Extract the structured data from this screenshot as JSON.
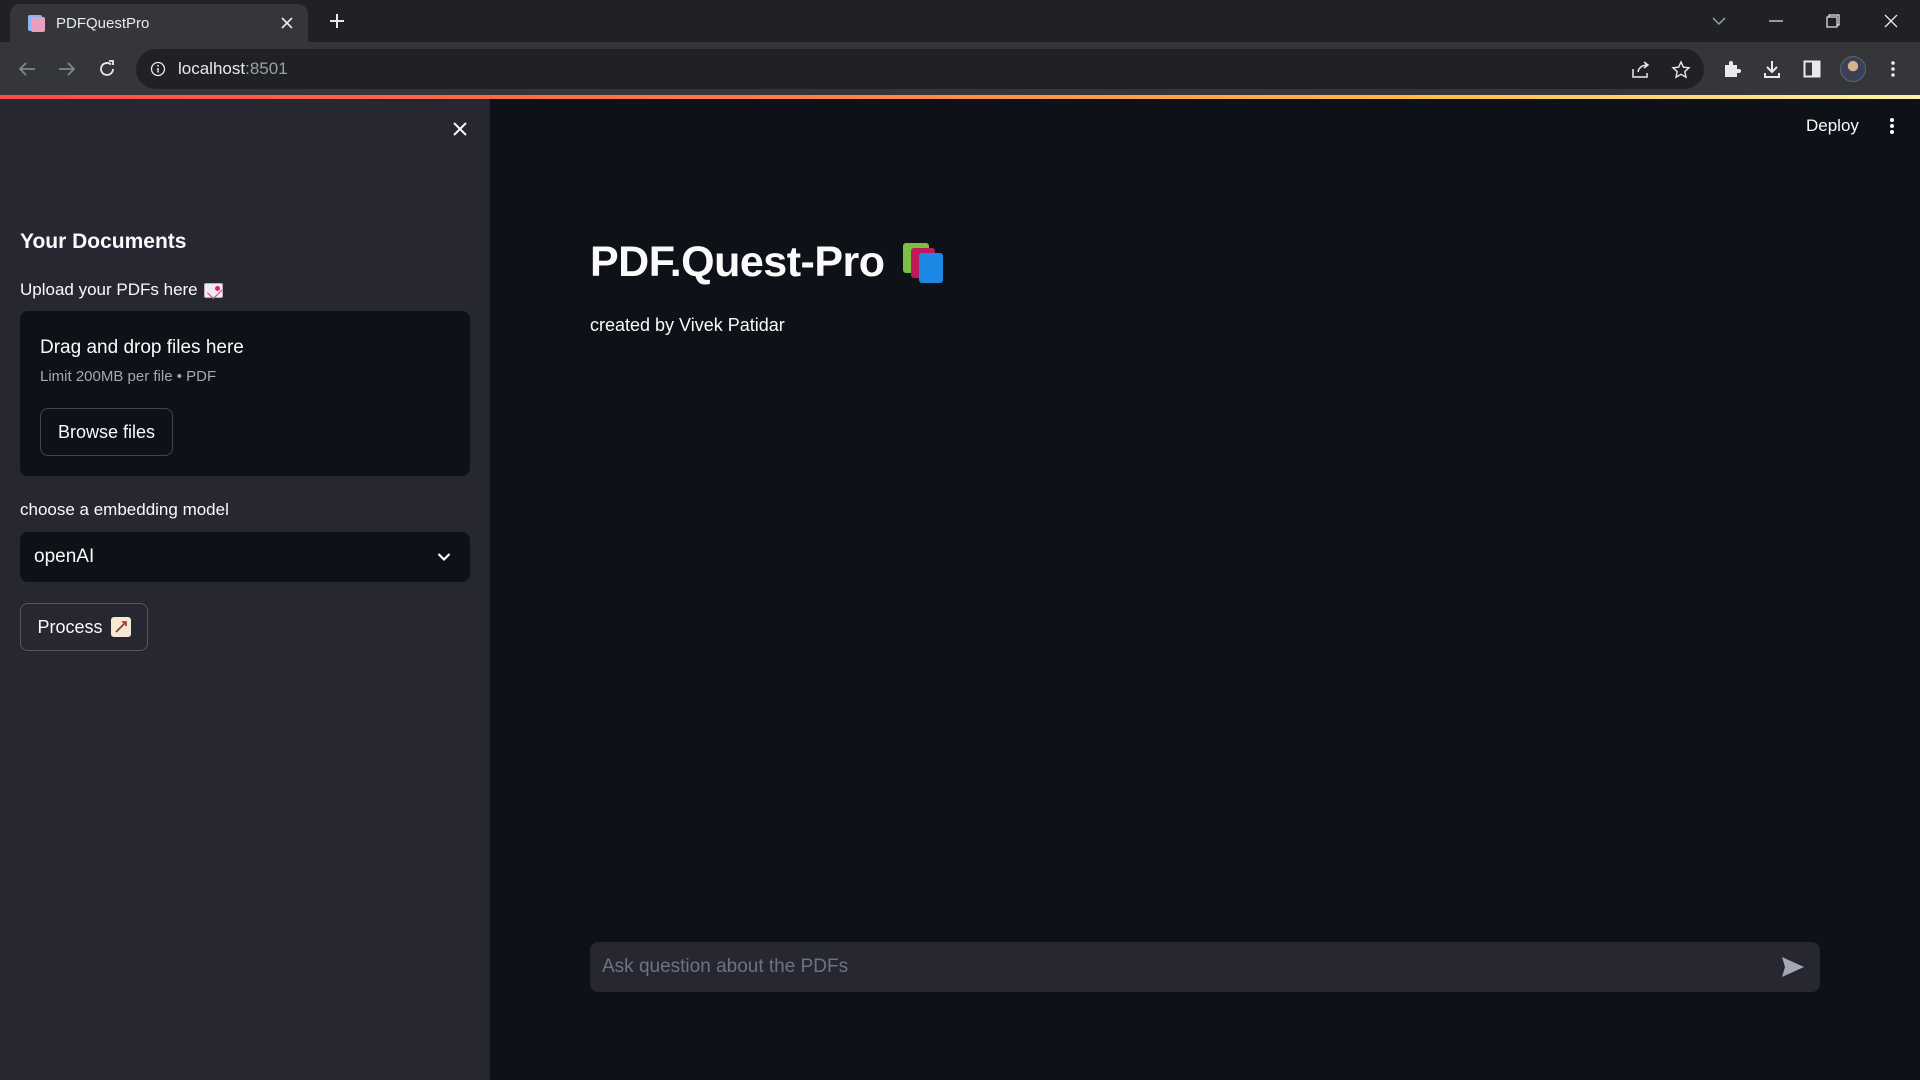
{
  "browser": {
    "tab_title": "PDFQuestPro",
    "url_host": "localhost",
    "url_port": ":8501",
    "icons": [
      "document-favicon",
      "close-icon",
      "plus-icon",
      "chevron-down-icon",
      "minimize-icon",
      "restore-icon",
      "close-window-icon",
      "back-arrow-icon",
      "forward-arrow-icon",
      "reload-icon",
      "info-icon",
      "share-icon",
      "star-icon",
      "puzzle-icon",
      "download-icon",
      "sidepanel-icon",
      "profile-avatar",
      "kebab-menu-icon"
    ]
  },
  "sidebar": {
    "heading": "Your Documents",
    "upload_label": "Upload your PDFs here",
    "dropzone_title": "Drag and drop files here",
    "dropzone_limit": "Limit 200MB per file • PDF",
    "browse_label": "Browse files",
    "model_label": "choose a embedding model",
    "model_selected": "openAI",
    "process_label": "Process"
  },
  "main": {
    "deploy_label": "Deploy",
    "title": "PDF.Quest-Pro",
    "subtitle": "created by Vivek Patidar",
    "chat_placeholder": "Ask question about the PDFs"
  },
  "colors": {
    "app_bg": "#0e1117",
    "sidebar_bg": "#262730",
    "accent_gradient_start": "#ff4b4b",
    "accent_gradient_end": "#fdf2a8"
  }
}
